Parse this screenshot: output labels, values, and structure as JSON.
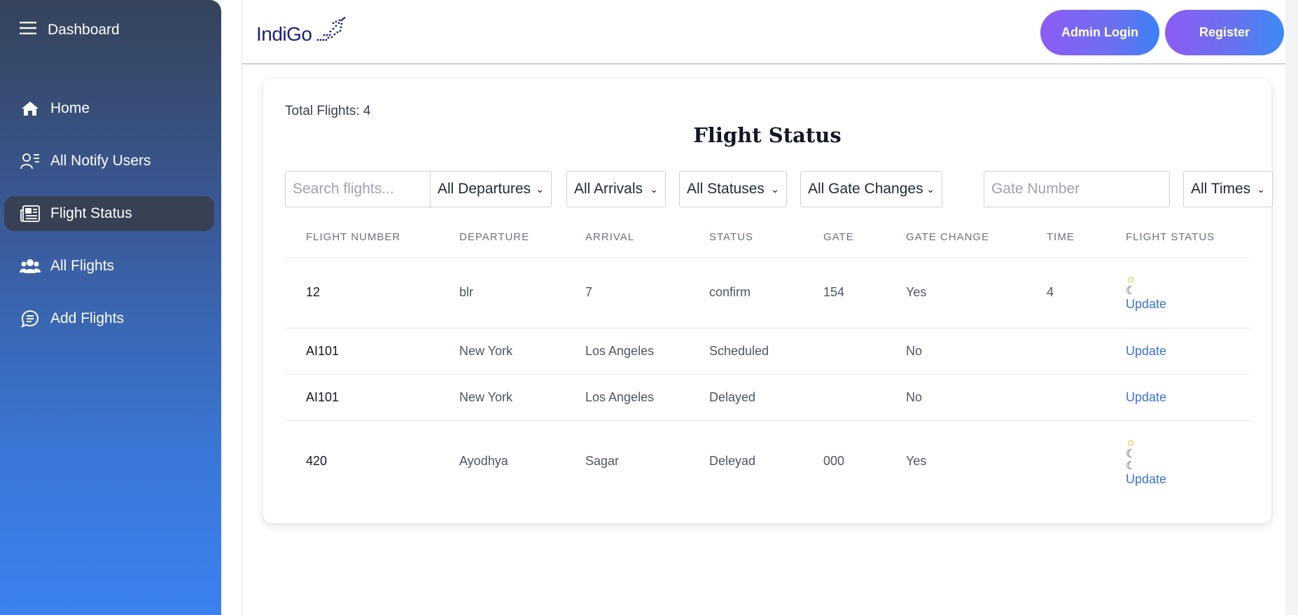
{
  "sidebar": {
    "title": "Dashboard",
    "items": [
      {
        "label": "Home",
        "icon": "home-icon",
        "active": false
      },
      {
        "label": "All Notify Users",
        "icon": "user-list-icon",
        "active": false
      },
      {
        "label": "Flight Status",
        "icon": "newspaper-icon",
        "active": true
      },
      {
        "label": "All Flights",
        "icon": "users-group-icon",
        "active": false
      },
      {
        "label": "Add Flights",
        "icon": "chat-icon",
        "active": false
      }
    ]
  },
  "header": {
    "logo_text": "IndiGo",
    "admin_login_label": "Admin Login",
    "register_label": "Register"
  },
  "main": {
    "total_flights": "Total Flights: 4",
    "title": "Flight Status",
    "filters": {
      "search_placeholder": "Search flights...",
      "departures": "All Departures",
      "arrivals": "All Arrivals",
      "statuses": "All Statuses",
      "gate_changes": "All Gate Changes",
      "gate_placeholder": "Gate Number",
      "times": "All Times"
    },
    "table": {
      "headers": [
        "FLIGHT NUMBER",
        "DEPARTURE",
        "ARRIVAL",
        "STATUS",
        "GATE",
        "GATE CHANGE",
        "TIME",
        "FLIGHT STATUS"
      ],
      "rows": [
        {
          "flight": "12",
          "departure": "blr",
          "arrival": "7",
          "status": "confirm",
          "gate": "154",
          "gate_change": "Yes",
          "time": "4",
          "icons": [
            "sun",
            "moon"
          ],
          "action": "Update"
        },
        {
          "flight": "AI101",
          "departure": "New York",
          "arrival": "Los Angeles",
          "status": "Scheduled",
          "gate": "",
          "gate_change": "No",
          "time": "",
          "icons": [],
          "action": "Update"
        },
        {
          "flight": "AI101",
          "departure": "New York",
          "arrival": "Los Angeles",
          "status": "Delayed",
          "gate": "",
          "gate_change": "No",
          "time": "",
          "icons": [],
          "action": "Update"
        },
        {
          "flight": "420",
          "departure": "Ayodhya",
          "arrival": "Sagar",
          "status": "Deleyad",
          "gate": "000",
          "gate_change": "Yes",
          "time": "",
          "icons": [
            "sun",
            "moon",
            "moon"
          ],
          "action": "Update"
        }
      ]
    }
  },
  "colors": {
    "sidebar_top": "#35435a",
    "sidebar_bottom": "#3b82f0",
    "button_start": "#8b5cf6",
    "button_end": "#3b82f6",
    "link": "#3b72d6"
  }
}
